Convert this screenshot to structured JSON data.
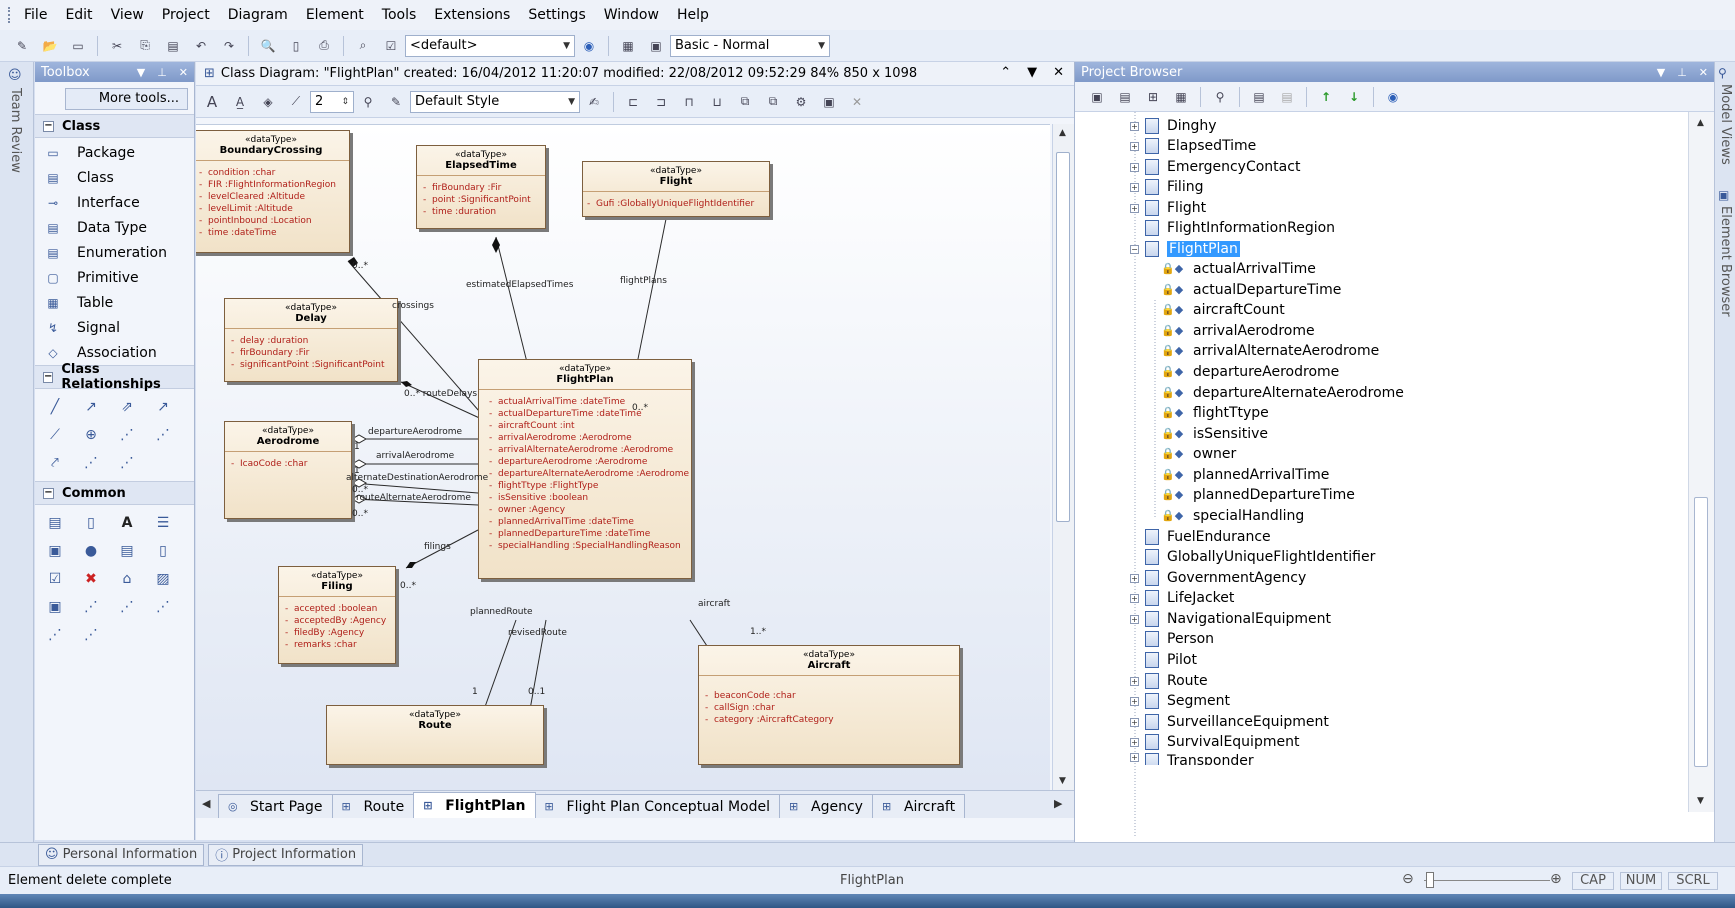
{
  "menu": [
    "File",
    "Edit",
    "View",
    "Project",
    "Diagram",
    "Element",
    "Tools",
    "Extensions",
    "Settings",
    "Window",
    "Help"
  ],
  "toolbar": {
    "default_combo": "<default>",
    "workspace_combo": "Basic - Normal"
  },
  "toolbox": {
    "title": "Toolbox",
    "more_tools": "More tools...",
    "class_section": "Class",
    "class_items": [
      "Package",
      "Class",
      "Interface",
      "Data Type",
      "Enumeration",
      "Primitive",
      "Table",
      "Signal",
      "Association"
    ],
    "relationships_section": "Class Relationships",
    "common_section": "Common"
  },
  "left_strip_label": "Team Review",
  "diagram": {
    "title": "Class Diagram: \"FlightPlan\"  created: 16/04/2012 11:20:07  modified: 22/08/2012 09:52:29  84%  850 x 1098",
    "line_width": "2",
    "style_combo": "Default Style",
    "classes": {
      "boundary": {
        "stereotype": "«dataType»",
        "name": "BoundaryCrossing",
        "attrs": [
          "condition  :char",
          "FIR  :FlightInformationRegion",
          "levelCleared  :Altitude",
          "levelLimit  :Altitude",
          "pointInbound  :Location",
          "time  :dateTime"
        ]
      },
      "elapsed": {
        "stereotype": "«dataType»",
        "name": "ElapsedTime",
        "attrs": [
          "firBoundary  :Fir",
          "point  :SignificantPoint",
          "time  :duration"
        ]
      },
      "flight": {
        "stereotype": "«dataType»",
        "name": "Flight",
        "attrs": [
          "Gufi  :GloballyUniqueFlightIdentifier"
        ]
      },
      "delay": {
        "stereotype": "«dataType»",
        "name": "Delay",
        "attrs": [
          "delay  :duration",
          "firBoundary  :Fir",
          "significantPoint  :SignificantPoint"
        ]
      },
      "flightplan": {
        "stereotype": "«dataType»",
        "name": "FlightPlan",
        "attrs": [
          "actualArrivalTime  :dateTime",
          "actualDepartureTime  :dateTime",
          "aircraftCount  :int",
          "arrivalAerodrome  :Aerodrome",
          "arrivalAlternateAerodrome  :Aerodrome",
          "departureAerodrome  :Aerodrome",
          "departureAlternateAerodrome  :Aerodrome",
          "flightTtype  :FlightType",
          "isSensitive  :boolean",
          "owner  :Agency",
          "plannedArrivalTime  :dateTime",
          "plannedDepartureTime  :dateTime",
          "specialHandling  :SpecialHandlingReason"
        ]
      },
      "aerodrome": {
        "stereotype": "«dataType»",
        "name": "Aerodrome",
        "attrs": [
          "IcaoCode  :char"
        ]
      },
      "filing": {
        "stereotype": "«dataType»",
        "name": "Filing",
        "attrs": [
          "accepted  :boolean",
          "acceptedBy  :Agency",
          "filedBy  :Agency",
          "remarks  :char"
        ]
      },
      "aircraft": {
        "stereotype": "«dataType»",
        "name": "Aircraft",
        "attrs": [
          "beaconCode  :char",
          "callSign  :char",
          "category  :AircraftCategory"
        ]
      },
      "route": {
        "stereotype": "«dataType»",
        "name": "Route",
        "attrs": []
      }
    },
    "labels": {
      "crossings": "crossings",
      "crossings_mult": "0..*",
      "estimated": "estimatedElapsedTimes",
      "flightplans": "flightPlans",
      "flightplans_mult": "0..*",
      "routedelays": "0..* routeDelays",
      "dep_aero": "departureAerodrome",
      "arr_aero": "arrivalAerodrome",
      "alt_dest": "alternateDestinationAerodrome",
      "route_alt": "routeAlternateAerodrome",
      "one": "1",
      "zero_many": "0..*",
      "filings": "filings",
      "filings_mult": "0..*",
      "planned_route": "plannedRoute",
      "revised_route": "revisedRoute",
      "aircraft": "aircraft",
      "one_many": "1..*",
      "zero_one": "0..1"
    },
    "tabs": [
      "Start Page",
      "Route",
      "FlightPlan",
      "Flight Plan Conceptual Model",
      "Agency",
      "Aircraft"
    ]
  },
  "browser": {
    "title": "Project Browser",
    "nodes_top": [
      "Dinghy",
      "ElapsedTime",
      "EmergencyContact",
      "Filing",
      "Flight",
      "FlightInformationRegion",
      "FlightPlan"
    ],
    "attributes": [
      "actualArrivalTime",
      "actualDepartureTime",
      "aircraftCount",
      "arrivalAerodrome",
      "arrivalAlternateAerodrome",
      "departureAerodrome",
      "departureAlternateAerodrome",
      "flightTtype",
      "isSensitive",
      "owner",
      "plannedArrivalTime",
      "plannedDepartureTime",
      "specialHandling"
    ],
    "nodes_bottom": [
      "FuelEndurance",
      "GloballyUniqueFlightIdentifier",
      "GovernmentAgency",
      "LifeJacket",
      "NavigationalEquipment",
      "Person",
      "Pilot",
      "Route",
      "Segment",
      "SurveillanceEquipment",
      "SurvivalEquipment",
      "Transponder"
    ]
  },
  "right_strip_labels": [
    "Model Views",
    "Element Browser"
  ],
  "info_tabs": [
    "Personal Information",
    "Project Information"
  ],
  "status": {
    "left": "Element delete complete",
    "center": "FlightPlan",
    "caps": "CAP",
    "num": "NUM",
    "scrl": "SCRL"
  }
}
